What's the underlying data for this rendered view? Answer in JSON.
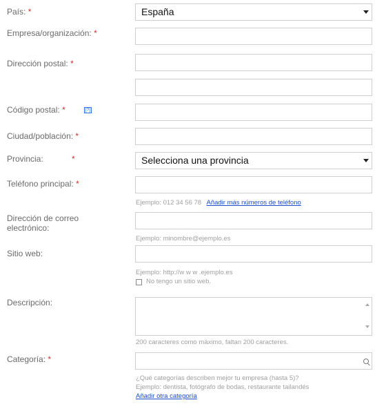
{
  "required_mark": "*",
  "country": {
    "label": "País:",
    "value": "España"
  },
  "company": {
    "label": "Empresa/organización:"
  },
  "address": {
    "label": "Dirección postal:"
  },
  "postal_code": {
    "label": "Código postal:",
    "help_icon": "[?]"
  },
  "city": {
    "label": "Ciudad/población:"
  },
  "province": {
    "label": "Provincia:",
    "value": "Selecciona una provincia"
  },
  "phone": {
    "label": "Teléfono principal:",
    "hint": "Ejemplo: 012 34 56 78",
    "add_link": "Añadir más números de teléfono"
  },
  "email": {
    "label_line1": "Dirección de correo",
    "label_line2": "electrónico:",
    "hint": "Ejemplo: minombre@ejemplo.es"
  },
  "website": {
    "label": "Sitio web:",
    "hint": "Ejemplo: http://w w w .ejemplo.es",
    "checkbox_label": "No tengo un sitio web."
  },
  "description": {
    "label": "Descripción:",
    "hint": "200 caracteres como máximo, faltan 200 caracteres."
  },
  "category": {
    "label": "Categoría:",
    "hint_line1": "¿Qué categorías describen mejor tu empresa (hasta 5)?",
    "hint_line2": "Ejemplo: dentista, fotógrafo de bodas, restaurante tailandés",
    "add_link": "Añadir otra categoría"
  }
}
